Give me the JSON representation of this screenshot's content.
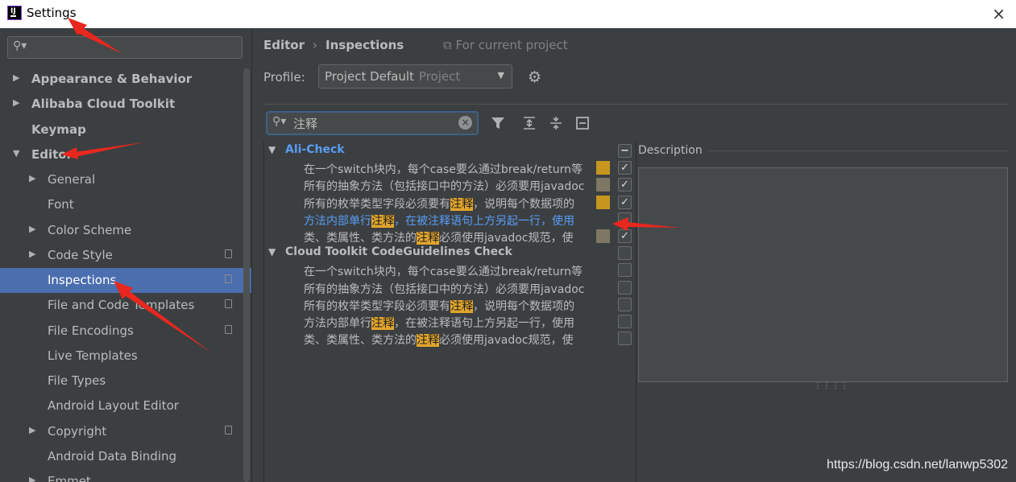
{
  "window": {
    "title": "Settings",
    "close_icon": "×"
  },
  "sidebar": {
    "search_placeholder": "",
    "items": [
      {
        "label": "Appearance & Behavior",
        "arrow": "▶"
      },
      {
        "label": "Alibaba Cloud Toolkit",
        "arrow": "▶"
      },
      {
        "label": "Keymap",
        "arrow": ""
      },
      {
        "label": "Editor",
        "arrow": "▼"
      },
      {
        "label": "General",
        "arrow": "▶"
      },
      {
        "label": "Font",
        "arrow": ""
      },
      {
        "label": "Color Scheme",
        "arrow": "▶"
      },
      {
        "label": "Code Style",
        "arrow": "▶"
      },
      {
        "label": "Inspections",
        "arrow": ""
      },
      {
        "label": "File and Code Templates",
        "arrow": ""
      },
      {
        "label": "File Encodings",
        "arrow": ""
      },
      {
        "label": "Live Templates",
        "arrow": ""
      },
      {
        "label": "File Types",
        "arrow": ""
      },
      {
        "label": "Android Layout Editor",
        "arrow": ""
      },
      {
        "label": "Copyright",
        "arrow": "▶"
      },
      {
        "label": "Android Data Binding",
        "arrow": ""
      },
      {
        "label": "Emmet",
        "arrow": "▶"
      }
    ],
    "selected": "Inspections"
  },
  "header": {
    "breadcrumb_root": "Editor",
    "breadcrumb_sep": "›",
    "breadcrumb_current": "Inspections",
    "scope_note": "For current project"
  },
  "profile": {
    "label": "Profile:",
    "value": "Project Default",
    "hint": "Project",
    "dropdown_icon": "▼"
  },
  "filter": {
    "value": "注释",
    "clear_icon": "×"
  },
  "toolbar": {
    "filter_icon": "funnel-icon",
    "expand_all_icon": "expand-all-icon",
    "collapse_all_icon": "collapse-all-icon",
    "reset_icon": "reset-icon"
  },
  "groups": [
    {
      "name": "Ali-Check",
      "expanded": true,
      "rows": [
        {
          "pre": "在一个switch块内，每个case要么通过break/return等",
          "hl": "",
          "post": "",
          "checked": true,
          "severity": "#c7961e"
        },
        {
          "pre": "所有的抽象方法（包括接口中的方法）必须要用javadoc",
          "hl": "",
          "post": "",
          "checked": true,
          "severity": "#7d7764"
        },
        {
          "pre": "所有的枚举类型字段必须要有",
          "hl": "注释",
          "post": "，说明每个数据项的",
          "checked": true,
          "severity": "#c7961e"
        },
        {
          "pre": "方法内部单行",
          "hl": "注释",
          "post": "，在被注释语句上方另起一行，使用",
          "checked": false,
          "severity": "",
          "blue": true
        },
        {
          "pre": "类、类属性、类方法的",
          "hl": "注释",
          "post": "必须使用javadoc规范，使",
          "checked": true,
          "severity": "#7d7764"
        }
      ]
    },
    {
      "name": "Cloud Toolkit CodeGuidelines Check",
      "expanded": true,
      "rows": [
        {
          "pre": "在一个switch块内，每个case要么通过break/return等",
          "hl": "",
          "post": "",
          "checked": false,
          "severity": ""
        },
        {
          "pre": "所有的抽象方法（包括接口中的方法）必须要用javadoc",
          "hl": "",
          "post": "",
          "checked": false,
          "severity": ""
        },
        {
          "pre": "所有的枚举类型字段必须要有",
          "hl": "注释",
          "post": "，说明每个数据项的",
          "checked": false,
          "severity": ""
        },
        {
          "pre": "方法内部单行",
          "hl": "注释",
          "post": "，在被注释语句上方另起一行，使用",
          "checked": false,
          "severity": ""
        },
        {
          "pre": "类、类属性、类方法的",
          "hl": "注释",
          "post": "必须使用javadoc规范，使",
          "checked": false,
          "severity": ""
        }
      ]
    }
  ],
  "description": {
    "label": "Description",
    "grip": "⋮⋮⋮⋮"
  },
  "watermark": "https://blog.csdn.net/lanwp5302",
  "colors": {
    "accent": "#4b6eaf",
    "link": "#589df6",
    "highlight": "#e2a52c",
    "annotation_arrow": "#e8271f"
  }
}
